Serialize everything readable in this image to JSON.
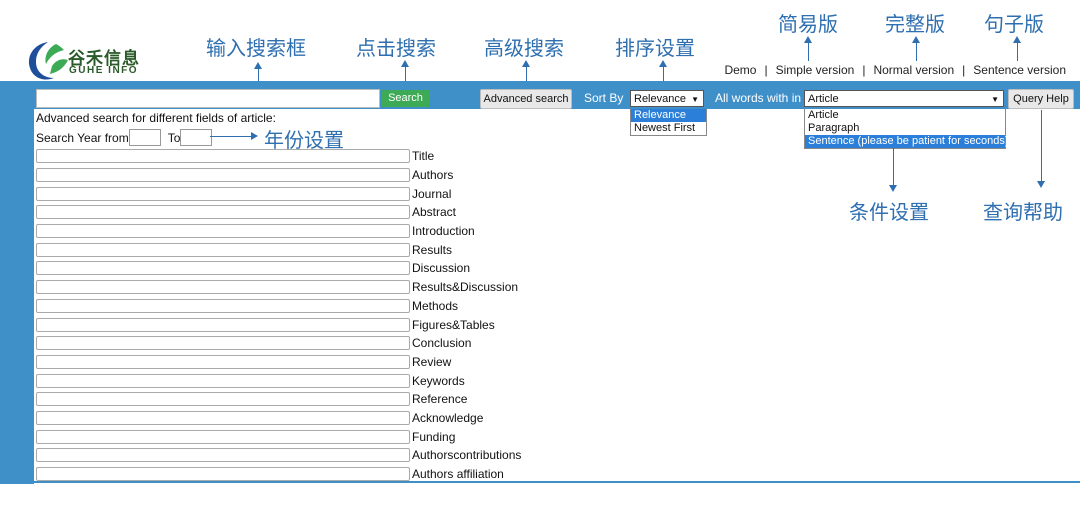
{
  "brand": {
    "name": "谷禾信息",
    "sub": "GUHE INFO",
    "colors": {
      "green": "#3daa55",
      "blue": "#3f8fc9",
      "navy": "#1f4f9a"
    }
  },
  "top_links": [
    "Demo",
    "Simple version",
    "Normal version",
    "Sentence version"
  ],
  "annotations": {
    "input_search": "输入搜索框",
    "click_search": "点击搜索",
    "advanced_search": "高级搜索",
    "sort_setting": "排序设置",
    "simple": "简易版",
    "full": "完整版",
    "sentence": "句子版",
    "year_setting": "年份设置",
    "condition_setting": "条件设置",
    "query_help": "查询帮助"
  },
  "toolbar": {
    "search_value": "",
    "search_label": "Search",
    "advanced_label": "Advanced search",
    "sort_by_label": "Sort By",
    "sort_selected": "Relevance",
    "sort_options": [
      "Relevance",
      "Newest First"
    ],
    "all_words_label": "All words with in",
    "field_selected": "Article",
    "field_options": [
      "Article",
      "Paragraph",
      "Sentence (please be patient for seconds)"
    ],
    "query_help_label": "Query Help"
  },
  "advanced": {
    "description": "Advanced search for different fields of article:",
    "year_from_label": "Search Year from",
    "year_to_label": "To",
    "fields": [
      "Title",
      "Authors",
      "Journal",
      "Abstract",
      "Introduction",
      "Results",
      "Discussion",
      "Results&Discussion",
      "Methods",
      "Figures&Tables",
      "Conclusion",
      "Review",
      "Keywords",
      "Reference",
      "Acknowledge",
      "Funding",
      "Authorscontributions",
      "Authors affiliation"
    ]
  }
}
